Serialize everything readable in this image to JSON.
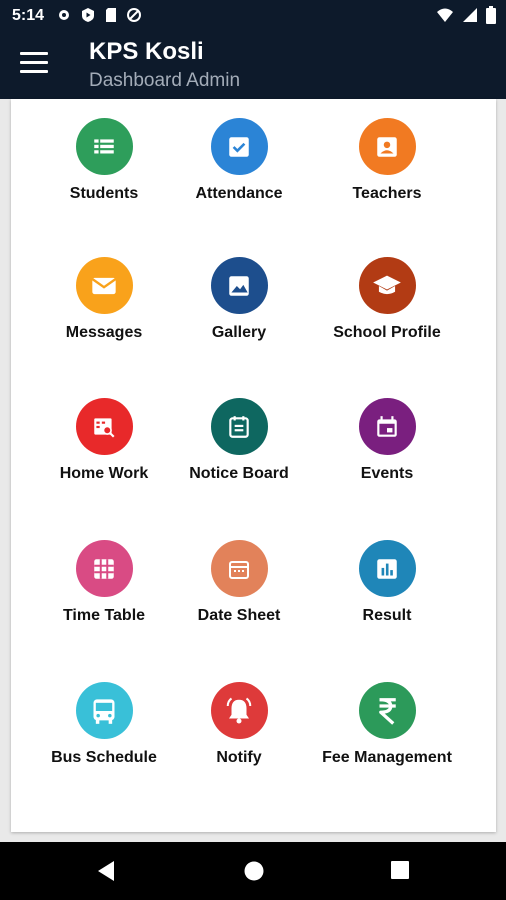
{
  "status": {
    "time": "5:14"
  },
  "header": {
    "title": "KPS Kosli",
    "subtitle": "Dashboard Admin"
  },
  "tiles": [
    {
      "label": "Students",
      "icon": "list-icon",
      "color": "#2e9e5b"
    },
    {
      "label": "Attendance",
      "icon": "check-box-icon",
      "color": "#2b84d6"
    },
    {
      "label": "Teachers",
      "icon": "person-card-icon",
      "color": "#f17a22"
    },
    {
      "label": "Messages",
      "icon": "mail-icon",
      "color": "#f9a21b"
    },
    {
      "label": "Gallery",
      "icon": "image-icon",
      "color": "#1d4e8d"
    },
    {
      "label": "School Profile",
      "icon": "graduation-cap-icon",
      "color": "#b23b14"
    },
    {
      "label": "Home Work",
      "icon": "homework-icon",
      "color": "#e8292a"
    },
    {
      "label": "Notice Board",
      "icon": "notice-icon",
      "color": "#0e6760"
    },
    {
      "label": "Events",
      "icon": "calendar-icon",
      "color": "#7a1f7f"
    },
    {
      "label": "Time Table",
      "icon": "grid-icon",
      "color": "#d94b84"
    },
    {
      "label": "Date Sheet",
      "icon": "calendar-icon",
      "color": "#e2825a"
    },
    {
      "label": "Result",
      "icon": "bar-chart-icon",
      "color": "#1f86b8"
    },
    {
      "label": "Bus Schedule",
      "icon": "bus-icon",
      "color": "#39c0d8"
    },
    {
      "label": "Notify",
      "icon": "bell-icon",
      "color": "#de3a3a"
    },
    {
      "label": "Fee Management",
      "icon": "rupee-icon",
      "color": "#2c9a5a"
    }
  ]
}
